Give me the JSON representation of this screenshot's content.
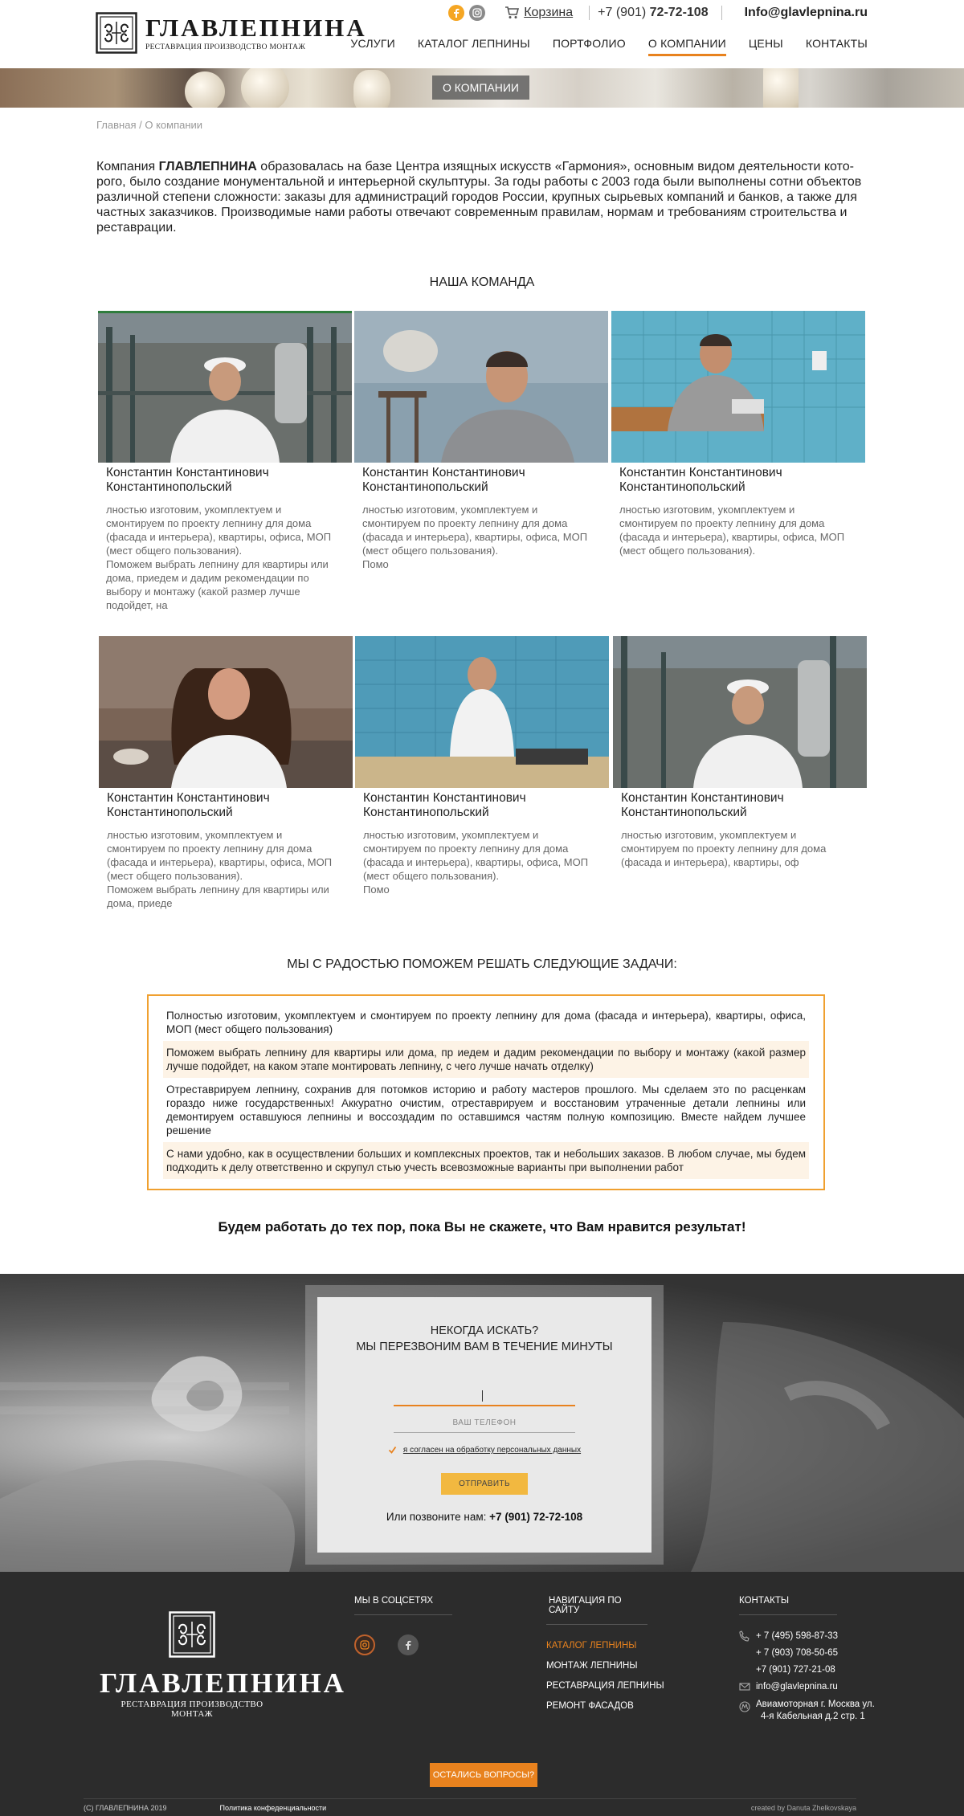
{
  "header": {
    "logo_name": "ГЛАВЛЕПНИНА",
    "logo_sub": "РЕСТАВРАЦИЯ ПРОИЗВОДСТВО МОНТАЖ",
    "cart_label": "Корзина",
    "phone_prefix": "+7 (901)",
    "phone_number": "72-72-108",
    "email": "Info@glavlepnina.ru",
    "nav": [
      {
        "label": "УСЛУГИ"
      },
      {
        "label": "КАТАЛОГ ЛЕПНИНЫ"
      },
      {
        "label": "ПОРТФОЛИО"
      },
      {
        "label": "О КОМПАНИИ",
        "active": true
      },
      {
        "label": "ЦЕНЫ"
      },
      {
        "label": "КОНТАКТЫ"
      }
    ]
  },
  "banner": {
    "title": "О КОМПАНИИ"
  },
  "breadcrumb": {
    "home": "Главная",
    "separator": "/",
    "current": "О компании"
  },
  "intro": {
    "prefix": "Компания ",
    "company": "ГЛАВЛЕПНИНА",
    "text": " образовалась на базе Центра изящных искусств «Гармония», основным видом деятельности кото-рого, было создание монументальной и интерьерной скульптуры. За годы работы с 2003 года были выполнены сотни объектов различной степени сложности: заказы для администраций городов России, крупных сырьевых компаний и банков, а также для частных заказчиков. Производимые нами работы отвечают современным правилам, нормам и требованиям строительства и реставрации."
  },
  "team": {
    "title": "НАША КОМАНДА",
    "members": [
      {
        "name": "Константин Константинович Константинопольский",
        "desc": "лностью изготовим, укомплектуем и смонтируем по проекту лепнину для дома (фасада и интерьера), квартиры, офиса, МОП (мест общего пользования).\nПоможем выбрать лепнину для квартиры или дома, приедем и дадим рекомендации по выбору и монтажу (какой размер лучше подойдет, на"
      },
      {
        "name": "Константин Константинович Константинопольский",
        "desc": "лностью изготовим, укомплектуем и смонтируем по проекту лепнину для дома (фасада и интерьера), квартиры, офиса, МОП (мест общего пользования).\nПомо"
      },
      {
        "name": "Константин Константинович Константинопольский",
        "desc": "лностью изготовим, укомплектуем и смонтируем по проекту лепнину для дома (фасада и интерьера), квартиры, офиса, МОП (мест общего пользования)."
      },
      {
        "name": "Константин Константинович Константинопольский",
        "desc": "лностью изготовим, укомплектуем и смонтируем по проекту лепнину для дома (фасада и интерьера), квартиры, офиса, МОП (мест общего пользования).\nПоможем выбрать лепнину для квартиры или дома, приеде"
      },
      {
        "name": "Константин Константинович Константинопольский",
        "desc": "лностью изготовим, укомплектуем и смонтируем по проекту лепнину для дома (фасада и интерьера), квартиры, офиса, МОП (мест общего пользования).\nПомо"
      },
      {
        "name": "Константин Константинович Константинопольский",
        "desc": "лностью изготовим, укомплектуем и смонтируем по проекту лепнину для дома (фасада и интерьера), квартиры, оф"
      }
    ]
  },
  "tasks": {
    "title": "МЫ С РАДОСТЬЮ ПОМОЖЕМ РЕШАТЬ СЛЕДУЮЩИЕ ЗАДАЧИ:",
    "items": [
      "Полностью изготовим, укомплектуем и смонтируем по проекту лепнину для дома (фасада и интерьера), квартиры, офиса, МОП (мест общего пользования)",
      "Поможем  выбрать лепнину для квартиры или дома, пр иедем и дадим рекомендации по выбору и монтажу (какой размер лучше подойдет, на каком этапе монтировать лепнину, с чего лучше начать отделку)",
      "Отреставрируем лепнину, сохранив для потомков историю  и  работу мастеров прошлого.  Мы сделаем это по  расценкам гораздо ниже государственных! Аккуратно очистим, отреставрируем и восстановим утраченные детали лепнины или демонтируем оставшуюся  лепнины и воссоздадим по оставшимся частям полную  композицию.  Вместе  найдем  лучшее решение",
      "С  нами  удобно,  как в  осуществлении  больших  и комплексных проектов, так и небольших заказов. В любом случае, мы будем подходить к делу ответственно и скрупул стью учесть всевозможные варианты при выполнении работ"
    ]
  },
  "slogan": "Будем работать до тех пор, пока Вы не скажете, что Вам нравится результат!",
  "callback": {
    "title_line1": "НЕКОГДА ИСКАТЬ?",
    "title_line2": "МЫ ПЕРЕЗВОНИМ ВАМ В ТЕЧЕНИЕ МИНУТЫ",
    "phone_placeholder": "ВАШ ТЕЛЕФОН",
    "agree_label": "я согласен на обработку персональных данных",
    "submit_label": "ОТПРАВИТЬ",
    "call_prefix": "Или позвоните нам:",
    "call_phone": "+7 (901) 72-72-108"
  },
  "footer": {
    "logo_name": "ГЛАВЛЕПНИНА",
    "logo_sub": "РЕСТАВРАЦИЯ ПРОИЗВОДСТВО МОНТАЖ",
    "social_title": "МЫ В СОЦСЕТЯХ",
    "nav_title": "НАВИГАЦИЯ ПО САЙТУ",
    "nav_links": [
      {
        "label": "КАТАЛОГ ЛЕПНИНЫ",
        "active": true
      },
      {
        "label": "МОНТАЖ ЛЕПНИНЫ"
      },
      {
        "label": "РЕСТАВРАЦИЯ ЛЕПНИНЫ"
      },
      {
        "label": "РЕМОНТ ФАСАДОВ"
      }
    ],
    "contacts_title": "КОНТАКТЫ",
    "phones": [
      "+ 7 (495) 598-87-33",
      "+ 7 (903) 708-50-65",
      "+7 (901) 727-21-08"
    ],
    "email": "info@glavlepnina.ru",
    "address_line1": "Авиамоторная г. Москва ул.",
    "address_line2": "4-я Кабельная д.2 стр. 1",
    "cta_label": "ОСТАЛИСЬ ВОПРОСЫ?",
    "copyright": "(C) ГЛАВЛЕПНИНА 2019",
    "policy": "Политика конфеденциальности",
    "credits": "created by Danuta Zhelkovskaya"
  },
  "colors": {
    "accent": "#e8821e",
    "facebook_icon": "#f5a623",
    "footer_bg": "#2c2c2c",
    "task_border": "#f0a030",
    "submit_button": "#f2b840"
  }
}
